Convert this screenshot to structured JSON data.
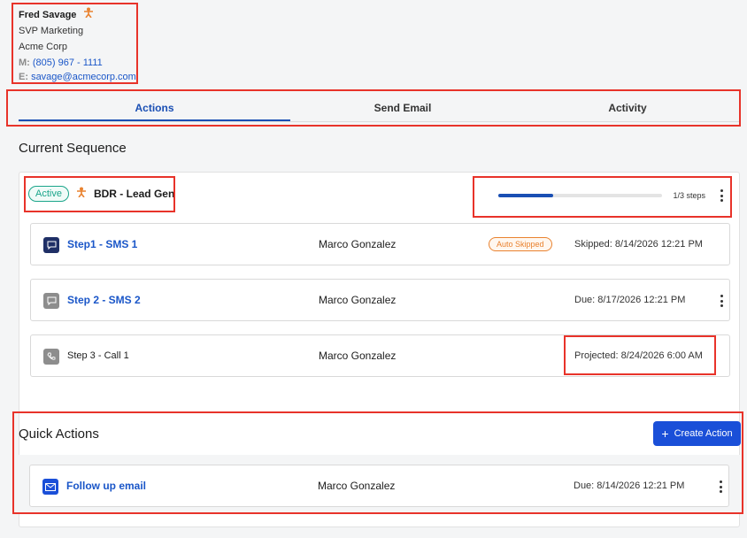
{
  "contact": {
    "name": "Fred Savage",
    "title": "SVP Marketing",
    "company": "Acme Corp",
    "mobile_label": "M:",
    "mobile": "(805) 967 - 1111",
    "email_label": "E:",
    "email": "savage@acmecorp.com"
  },
  "tabs": [
    {
      "label": "Actions"
    },
    {
      "label": "Send Email"
    },
    {
      "label": "Activity"
    }
  ],
  "current_sequence": {
    "heading": "Current Sequence",
    "status": "Active",
    "name": "BDR - Lead Gen",
    "progress_fraction": 0.333,
    "steps_text": "1/3 steps",
    "steps": [
      {
        "title": "Step1 - SMS 1",
        "owner": "Marco Gonzalez",
        "badge": "Auto Skipped",
        "when": "Skipped: 8/14/2026 12:21 PM"
      },
      {
        "title": "Step 2 - SMS 2",
        "owner": "Marco Gonzalez",
        "when": "Due: 8/17/2026 12:21 PM"
      },
      {
        "title": "Step 3 - Call 1",
        "owner": "Marco Gonzalez",
        "when": "Projected: 8/24/2026 6:00 AM"
      }
    ]
  },
  "quick_actions": {
    "heading": "Quick Actions",
    "create_label": "Create Action",
    "items": [
      {
        "title": "Follow up email",
        "owner": "Marco Gonzalez",
        "when": "Due: 8/14/2026 12:21 PM"
      }
    ]
  },
  "colors": {
    "accent": "#1a4fb4",
    "link": "#1a56c8",
    "active_badge": "#1aa58a",
    "auto_skip": "#e9822f",
    "highlight": "#e8332a"
  }
}
